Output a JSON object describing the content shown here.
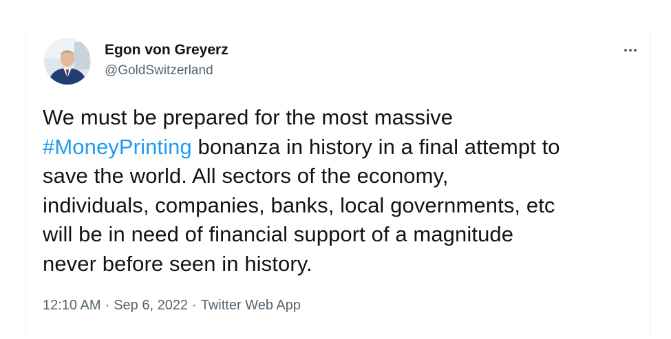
{
  "tweet": {
    "author": {
      "display_name": "Egon von Greyerz",
      "handle": "@GoldSwitzerland"
    },
    "more_icon": "more-horizontal-icon",
    "text_lines": [
      [
        "We must be prepared for the most massive"
      ],
      [
        "#MoneyPrinting",
        " bonanza in history in a final attempt to"
      ],
      [
        "save the world. All sectors of the economy,"
      ],
      [
        "individuals, companies, banks, local governments, etc"
      ],
      [
        "will be in need of financial support of a magnitude"
      ],
      [
        "never before seen in history."
      ]
    ],
    "hashtag": "#MoneyPrinting",
    "line2_rest": " bonanza in history in a final attempt to",
    "line1": "We must be prepared for the most massive",
    "line3": "save the world. All sectors of the economy,",
    "line4": "individuals, companies, banks, local governments, etc",
    "line5": "will be in need of financial support of a magnitude",
    "line6": "never before seen in history.",
    "time": "12:10 AM",
    "separator": "·",
    "date": "Sep 6, 2022",
    "source": "Twitter Web App",
    "colors": {
      "hashtag": "#1d9bf0",
      "secondary_text": "#536471",
      "primary_text": "#0f1419"
    }
  }
}
